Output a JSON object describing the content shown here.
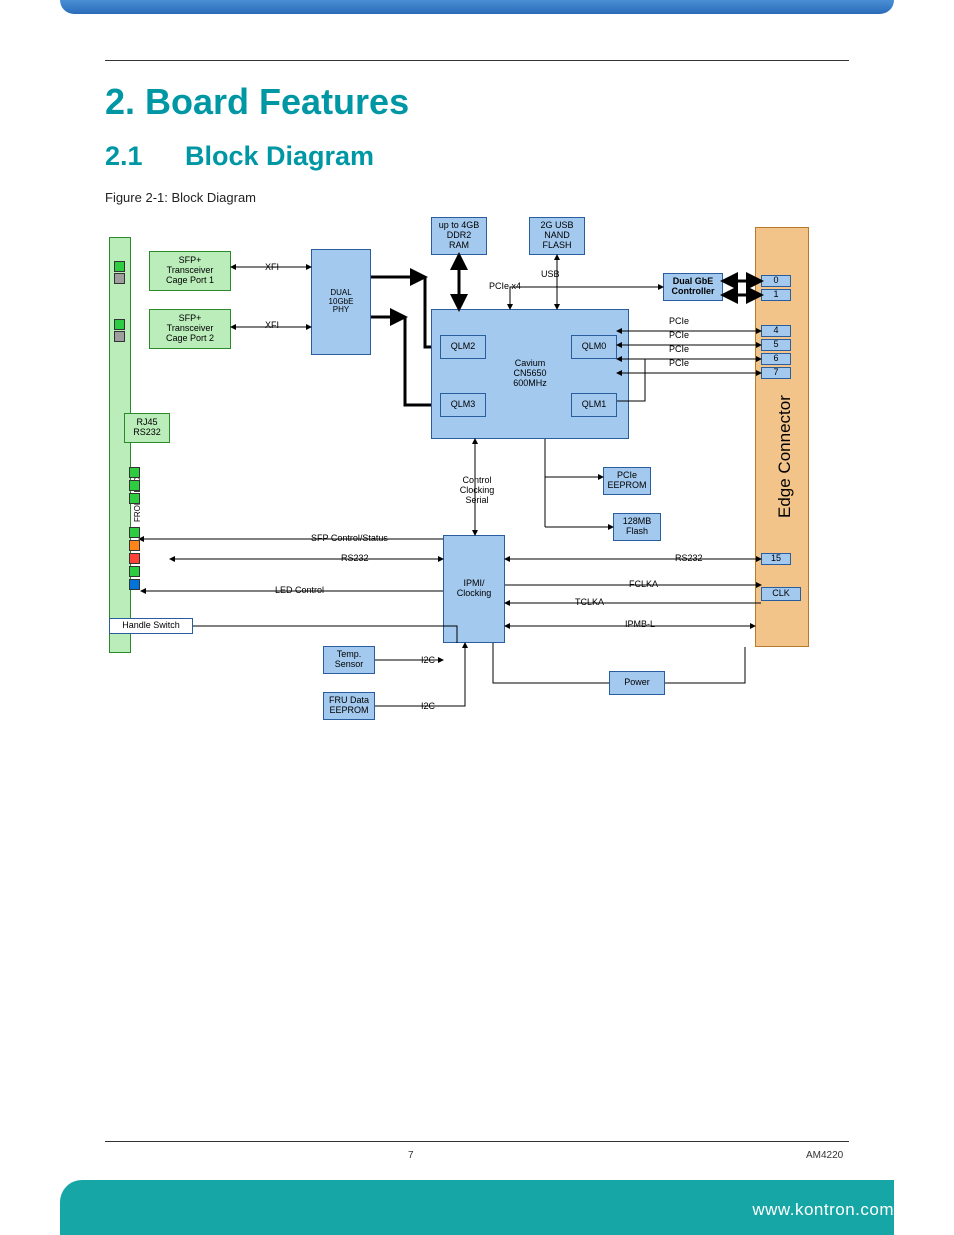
{
  "header": {
    "chapter_title": "2.  Board Features",
    "section_number": "2.1",
    "section_title": "Block Diagram",
    "figure_caption": "Figure 2-1: Block Diagram"
  },
  "diagram": {
    "blocks": {
      "sfp1": "SFP+\nTransceiver\nCage Port 1",
      "sfp2": "SFP+\nTransceiver\nCage Port 2",
      "rj45": "RJ45\nRS232",
      "front_leds": "FRONT LEDs",
      "handle": "Handle Switch",
      "phy": "DUAL\n10GbE\nPHY",
      "ddr2": "up to 4GB\nDDR2\nRAM",
      "nand": "2G USB\nNAND\nFLASH",
      "cavium": "Cavium\nCN5650\n600MHz",
      "qlm0": "QLM0",
      "qlm1": "QLM1",
      "qlm2": "QLM2",
      "qlm3": "QLM3",
      "ipmi": "IPMI/\nClocking",
      "temp": "Temp.\nSensor",
      "fru": "FRU Data\nEEPROM",
      "pcie_eeprom": "PCIe\nEEPROM",
      "flash128": "128MB\nFlash",
      "power": "Power",
      "gbe": "Dual GbE\nController",
      "edge": "Edge Connector",
      "pins": {
        "p0": "0",
        "p1": "1",
        "p4": "4",
        "p5": "5",
        "p6": "6",
        "p7": "7",
        "p15": "15",
        "clk": "CLK"
      }
    },
    "signals": {
      "xfi1": "XFI",
      "xfi2": "XFI",
      "usb": "USB",
      "pcie_x4": "PCIe x4",
      "pcie": "PCIe",
      "control": "Control\nClocking\nSerial",
      "sfp_ctrl": "SFP Control/Status",
      "rs232": "RS232",
      "led_ctrl": "LED Control",
      "i2c": "I2C",
      "fclka": "FCLKA",
      "tclka": "TCLKA",
      "ipmb": "IPMB-L"
    }
  },
  "footer": {
    "page_number": "7",
    "doc_id": "AM4220",
    "url": "www.kontron.com"
  }
}
